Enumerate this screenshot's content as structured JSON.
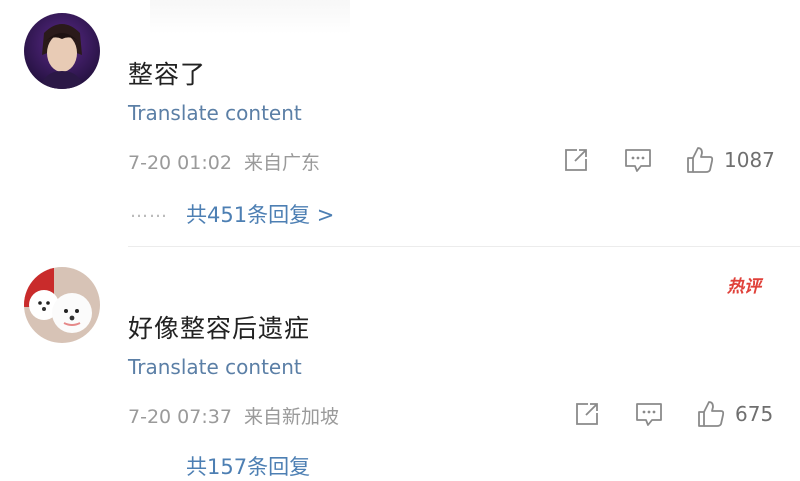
{
  "comments": [
    {
      "text": "整容了",
      "translate_label": "Translate content",
      "timestamp": "7-20 01:02",
      "location": "来自广东",
      "like_count": "1087",
      "replies": {
        "ellipsis": "……",
        "label": "共451条回复 >"
      }
    },
    {
      "text": "好像整容后遗症",
      "badge": "热评",
      "translate_label": "Translate content",
      "timestamp": "7-20 07:37",
      "location": "来自新加坡",
      "like_count": "675",
      "replies": {
        "label": "共157条回复"
      }
    }
  ],
  "colors": {
    "link": "#5b7fa6",
    "reply_link": "#4d7fb3",
    "meta": "#9a9a9a",
    "hot_badge": "#e0413a"
  },
  "icons": [
    "share-icon",
    "comment-icon",
    "like-icon"
  ]
}
